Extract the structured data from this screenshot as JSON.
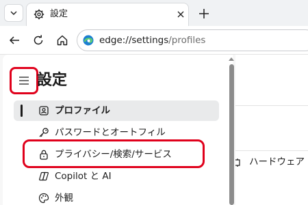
{
  "tab": {
    "title": "設定"
  },
  "address_bar": {
    "url_host": "edge://settings",
    "url_path": "/profiles"
  },
  "settings": {
    "title": "設定",
    "nav": [
      {
        "label": "プロファイル",
        "selected": true,
        "icon": "profile-icon"
      },
      {
        "label": "パスワードとオートフィル",
        "selected": false,
        "icon": "key-icon"
      },
      {
        "label": "プライバシー/検索/サービス",
        "selected": false,
        "icon": "lock-icon"
      },
      {
        "label": "Copilot と AI",
        "selected": false,
        "icon": "copilot-icon"
      },
      {
        "label": "外観",
        "selected": false,
        "icon": "palette-icon"
      }
    ]
  },
  "main": {
    "partial_item_label": "ハードウェア"
  },
  "colors": {
    "highlight": "#e0001b",
    "selected_bg": "#e9eaeb"
  }
}
